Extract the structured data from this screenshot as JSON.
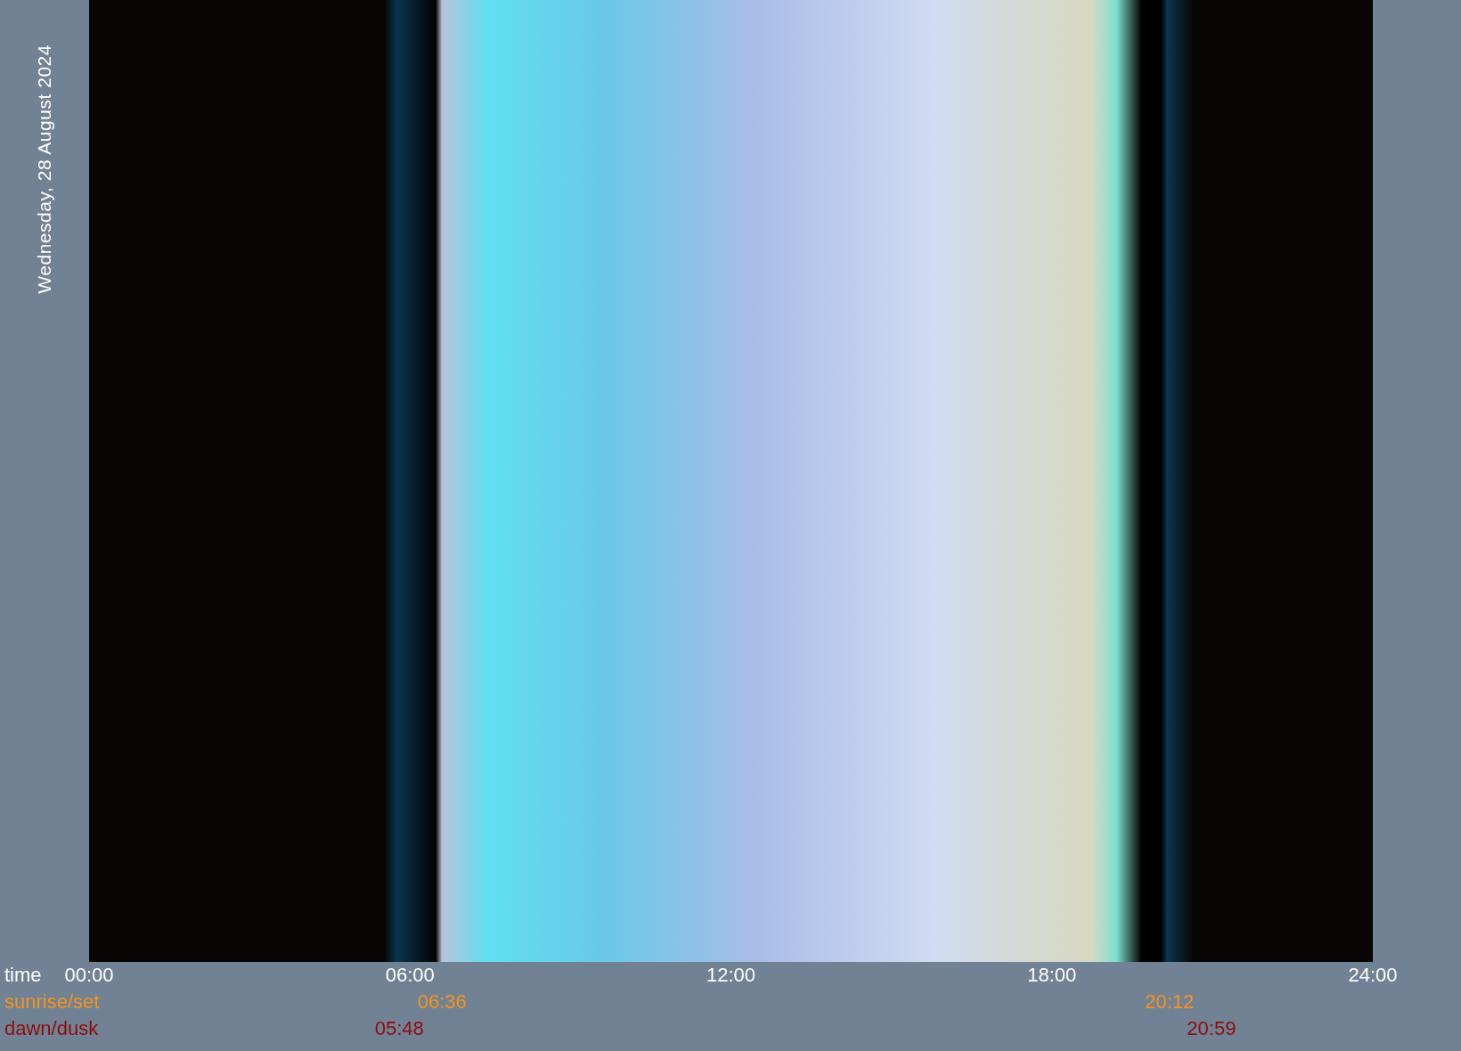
{
  "date_label": "Wednesday, 28 August 2024",
  "rows": [
    {
      "kind": "time",
      "label": "time",
      "values": [
        "00:00",
        "06:00",
        "12:00",
        "18:00",
        "24:00"
      ]
    },
    {
      "kind": "sunrise",
      "label": "sunrise/set",
      "values": [
        "06:36",
        "20:12"
      ]
    },
    {
      "kind": "dawn",
      "label": "dawn/dusk",
      "values": [
        "05:48",
        "20:59"
      ]
    }
  ]
}
